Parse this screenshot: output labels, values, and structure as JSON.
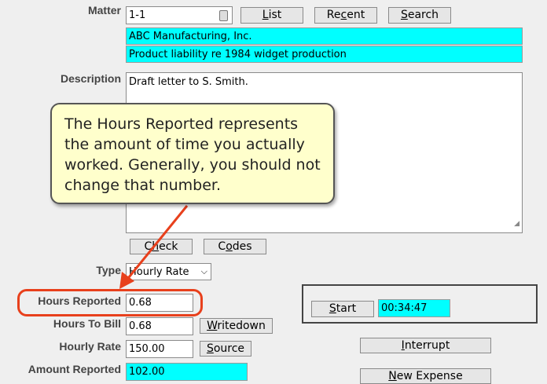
{
  "labels": {
    "matter": "Matter",
    "description": "Description",
    "type": "Type",
    "hours_reported": "Hours Reported",
    "hours_to_bill": "Hours To Bill",
    "hourly_rate": "Hourly Rate",
    "amount_reported": "Amount Reported"
  },
  "matter": {
    "value": "1-1",
    "client": "ABC Manufacturing, Inc.",
    "matter_name": "Product liability re 1984 widget production"
  },
  "buttons": {
    "list": {
      "pre": "",
      "key": "L",
      "post": "ist"
    },
    "recent": {
      "pre": "Re",
      "key": "c",
      "post": "ent"
    },
    "search": {
      "pre": "",
      "key": "S",
      "post": "earch"
    },
    "check": {
      "pre": "C",
      "key": "h",
      "post": "eck"
    },
    "codes": {
      "pre": "C",
      "key": "o",
      "post": "des"
    },
    "writedown": {
      "pre": "",
      "key": "W",
      "post": "ritedown"
    },
    "source": {
      "pre": "",
      "key": "S",
      "post": "ource"
    },
    "start": {
      "pre": "",
      "key": "S",
      "post": "tart"
    },
    "interrupt": {
      "pre": "",
      "key": "I",
      "post": "nterrupt"
    },
    "new_expense": {
      "pre": "",
      "key": "N",
      "post": "ew Expense"
    }
  },
  "description": {
    "value": "Draft letter to S. Smith."
  },
  "type": {
    "selected": "Hourly Rate"
  },
  "fields": {
    "hours_reported": "0.68",
    "hours_to_bill": "0.68",
    "hourly_rate": "150.00",
    "amount_reported": "102.00"
  },
  "timer": {
    "value": "00:34:47"
  },
  "callout": {
    "text": "The Hours Reported represents the amount of time you actually worked. Generally, you should not change that number."
  },
  "colors": {
    "highlight": "#00ffff",
    "annotation": "#e8401c",
    "callout_bg": "#ffffcc"
  }
}
